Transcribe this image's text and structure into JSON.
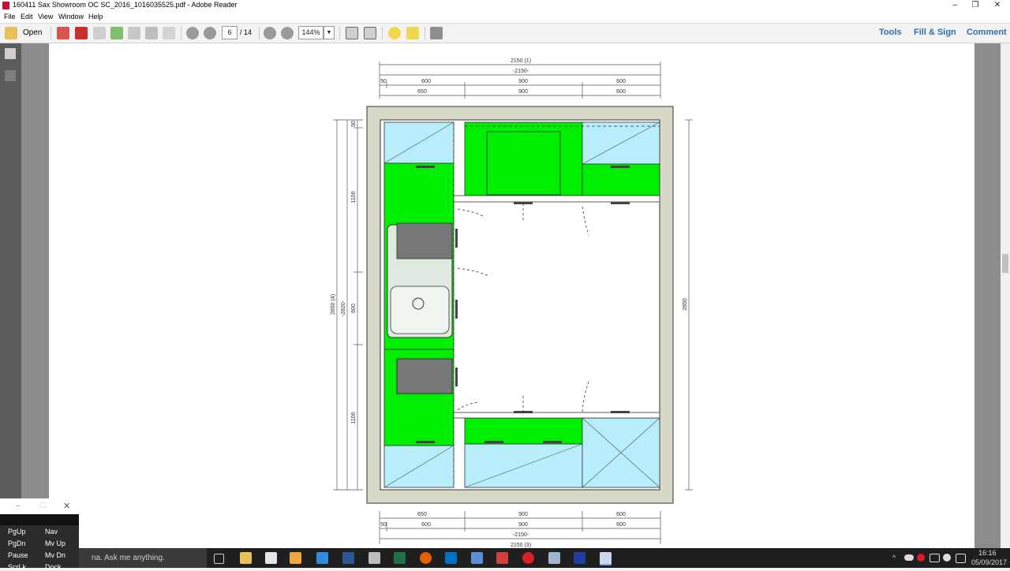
{
  "window": {
    "title": "160411 Sax Showroom OC SC_2016_1016035525.pdf - Adobe Reader",
    "minimize": "–",
    "maximize": "❐",
    "close": "✕"
  },
  "menu": [
    "File",
    "Edit",
    "View",
    "Window",
    "Help"
  ],
  "toolbar": {
    "open_label": "Open",
    "page_current": "6",
    "page_total": "/ 14",
    "zoom": "144%",
    "tools_label": "Tools",
    "fill_sign_label": "Fill & Sign",
    "comment_label": "Comment"
  },
  "drawing": {
    "top_total_label": "2150 (1)",
    "top_total_inner": "-2150-",
    "top_row1": [
      "50",
      "600",
      "900",
      "600"
    ],
    "top_row2": [
      "650",
      "900",
      "600"
    ],
    "left_small": "50",
    "left_upper": "1100",
    "left_mid": "600",
    "left_lower": "1100",
    "left_total1": "2850 (4)",
    "left_total2": "-2820-",
    "right_total": "2850",
    "bottom_row1": [
      "650",
      "900",
      "600"
    ],
    "bottom_row2": [
      "50",
      "600",
      "900",
      "600"
    ],
    "bottom_total_inner": "-2150-",
    "bottom_total_label": "2150 (3)",
    "colors": {
      "wall": "#d8d8c8",
      "unit_green": "#00ee00",
      "unit_blue": "#b8eefc"
    }
  },
  "keyboard_window": {
    "keys": [
      "PgUp",
      "Nav",
      "PgDn",
      "Mv Up",
      "Pause",
      "Mv Dn",
      "ScrLk",
      "Dock"
    ]
  },
  "taskbar": {
    "search_placeholder": "na. Ask me anything.",
    "time": "16:16",
    "date": "05/09/2017"
  }
}
